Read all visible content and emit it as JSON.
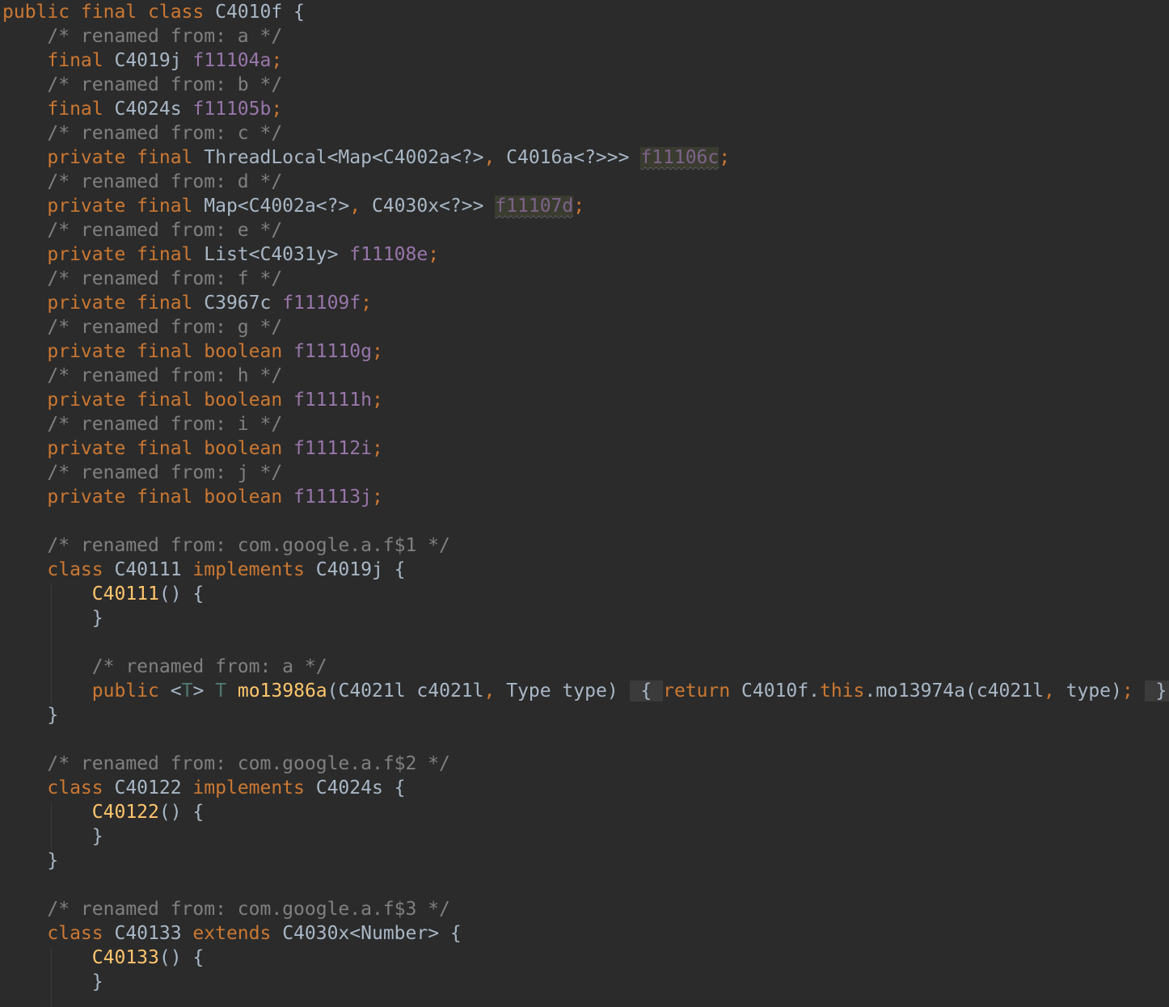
{
  "editor": {
    "lines": [
      [
        {
          "t": "public final class",
          "c": "kw"
        },
        {
          "t": " C4010f {",
          "c": "pl"
        }
      ],
      [
        {
          "t": "    /* renamed from: a */",
          "c": "cm"
        }
      ],
      [
        {
          "t": "    final",
          "c": "kw"
        },
        {
          "t": " C4019j ",
          "c": "pl"
        },
        {
          "t": "f11104a",
          "c": "fd"
        },
        {
          "t": ";",
          "c": "kw"
        }
      ],
      [
        {
          "t": "    /* renamed from: b */",
          "c": "cm"
        }
      ],
      [
        {
          "t": "    final",
          "c": "kw"
        },
        {
          "t": " C4024s ",
          "c": "pl"
        },
        {
          "t": "f11105b",
          "c": "fd"
        },
        {
          "t": ";",
          "c": "kw"
        }
      ],
      [
        {
          "t": "    /* renamed from: c */",
          "c": "cm"
        }
      ],
      [
        {
          "t": "    private final",
          "c": "kw"
        },
        {
          "t": " ThreadLocal<Map<C4002a<?>",
          "c": "pl"
        },
        {
          "t": ",",
          "c": "kw"
        },
        {
          "t": " C4016a<?>>> ",
          "c": "pl"
        },
        {
          "t": "f11106c",
          "c": "hl"
        },
        {
          "t": ";",
          "c": "kw"
        }
      ],
      [
        {
          "t": "    /* renamed from: d */",
          "c": "cm"
        }
      ],
      [
        {
          "t": "    private final",
          "c": "kw"
        },
        {
          "t": " Map<C4002a<?>",
          "c": "pl"
        },
        {
          "t": ",",
          "c": "kw"
        },
        {
          "t": " C4030x<?>> ",
          "c": "pl"
        },
        {
          "t": "f11107d",
          "c": "hl"
        },
        {
          "t": ";",
          "c": "kw"
        }
      ],
      [
        {
          "t": "    /* renamed from: e */",
          "c": "cm"
        }
      ],
      [
        {
          "t": "    private final",
          "c": "kw"
        },
        {
          "t": " List<C4031y> ",
          "c": "pl"
        },
        {
          "t": "f11108e",
          "c": "fd"
        },
        {
          "t": ";",
          "c": "kw"
        }
      ],
      [
        {
          "t": "    /* renamed from: f */",
          "c": "cm"
        }
      ],
      [
        {
          "t": "    private final",
          "c": "kw"
        },
        {
          "t": " C3967c ",
          "c": "pl"
        },
        {
          "t": "f11109f",
          "c": "fd"
        },
        {
          "t": ";",
          "c": "kw"
        }
      ],
      [
        {
          "t": "    /* renamed from: g */",
          "c": "cm"
        }
      ],
      [
        {
          "t": "    private final boolean",
          "c": "kw"
        },
        {
          "t": " ",
          "c": "pl"
        },
        {
          "t": "f11110g",
          "c": "fd"
        },
        {
          "t": ";",
          "c": "kw"
        }
      ],
      [
        {
          "t": "    /* renamed from: h */",
          "c": "cm"
        }
      ],
      [
        {
          "t": "    private final boolean",
          "c": "kw"
        },
        {
          "t": " ",
          "c": "pl"
        },
        {
          "t": "f11111h",
          "c": "fd"
        },
        {
          "t": ";",
          "c": "kw"
        }
      ],
      [
        {
          "t": "    /* renamed from: i */",
          "c": "cm"
        }
      ],
      [
        {
          "t": "    private final boolean",
          "c": "kw"
        },
        {
          "t": " ",
          "c": "pl"
        },
        {
          "t": "f11112i",
          "c": "fd"
        },
        {
          "t": ";",
          "c": "kw"
        }
      ],
      [
        {
          "t": "    /* renamed from: j */",
          "c": "cm"
        }
      ],
      [
        {
          "t": "    private final boolean",
          "c": "kw"
        },
        {
          "t": " ",
          "c": "pl"
        },
        {
          "t": "f11113j",
          "c": "fd"
        },
        {
          "t": ";",
          "c": "kw"
        }
      ],
      [],
      [
        {
          "t": "    /* renamed from: com.google.a.f$1 */",
          "c": "cm"
        }
      ],
      [
        {
          "t": "    class",
          "c": "kw"
        },
        {
          "t": " C40111 ",
          "c": "pl"
        },
        {
          "t": "implements",
          "c": "kw"
        },
        {
          "t": " C4019j {",
          "c": "pl"
        }
      ],
      [
        {
          "t": "        ",
          "c": "pl"
        },
        {
          "t": "C40111",
          "c": "fn"
        },
        {
          "t": "() {",
          "c": "pl"
        }
      ],
      [
        {
          "t": "        }",
          "c": "pl"
        }
      ],
      [],
      [
        {
          "t": "        /* renamed from: a */",
          "c": "cm"
        }
      ],
      [
        {
          "t": "        public",
          "c": "kw"
        },
        {
          "t": " <",
          "c": "pl"
        },
        {
          "t": "T",
          "c": "tp"
        },
        {
          "t": "> ",
          "c": "pl"
        },
        {
          "t": "T",
          "c": "tp"
        },
        {
          "t": " ",
          "c": "pl"
        },
        {
          "t": "mo13986a",
          "c": "fn"
        },
        {
          "t": "(C4021l c4021l",
          "c": "pl"
        },
        {
          "t": ",",
          "c": "kw"
        },
        {
          "t": " Type type) ",
          "c": "pl"
        },
        {
          "t": " { ",
          "c": "fold"
        },
        {
          "t": "return",
          "c": "kw"
        },
        {
          "t": " C4010f.",
          "c": "pl"
        },
        {
          "t": "this",
          "c": "kw"
        },
        {
          "t": ".mo13974a(c4021l",
          "c": "pl"
        },
        {
          "t": ",",
          "c": "kw"
        },
        {
          "t": " type)",
          "c": "pl"
        },
        {
          "t": ";",
          "c": "kw"
        },
        {
          "t": " ",
          "c": "pl"
        },
        {
          "t": " } ",
          "c": "fold"
        }
      ],
      [
        {
          "t": "    }",
          "c": "pl"
        }
      ],
      [],
      [
        {
          "t": "    /* renamed from: com.google.a.f$2 */",
          "c": "cm"
        }
      ],
      [
        {
          "t": "    class",
          "c": "kw"
        },
        {
          "t": " C40122 ",
          "c": "pl"
        },
        {
          "t": "implements",
          "c": "kw"
        },
        {
          "t": " C4024s {",
          "c": "pl"
        }
      ],
      [
        {
          "t": "        ",
          "c": "pl"
        },
        {
          "t": "C40122",
          "c": "fn"
        },
        {
          "t": "() {",
          "c": "pl"
        }
      ],
      [
        {
          "t": "        }",
          "c": "pl"
        }
      ],
      [
        {
          "t": "    }",
          "c": "pl"
        }
      ],
      [],
      [
        {
          "t": "    /* renamed from: com.google.a.f$3 */",
          "c": "cm"
        }
      ],
      [
        {
          "t": "    class",
          "c": "kw"
        },
        {
          "t": " C40133 ",
          "c": "pl"
        },
        {
          "t": "extends",
          "c": "kw"
        },
        {
          "t": " C4030x<Number> {",
          "c": "pl"
        }
      ],
      [
        {
          "t": "        ",
          "c": "pl"
        },
        {
          "t": "C40133",
          "c": "fn"
        },
        {
          "t": "() {",
          "c": "pl"
        }
      ],
      [
        {
          "t": "        }",
          "c": "pl"
        }
      ]
    ]
  }
}
